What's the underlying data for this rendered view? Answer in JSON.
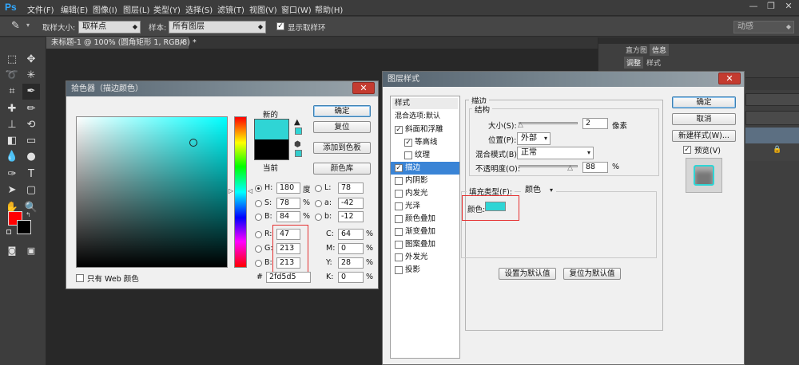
{
  "app": {
    "logo": "Ps",
    "menus": [
      "文件(F)",
      "编辑(E)",
      "图像(I)",
      "图层(L)",
      "类型(Y)",
      "选择(S)",
      "滤镜(T)",
      "视图(V)",
      "窗口(W)",
      "帮助(H)"
    ],
    "window_controls": [
      "—",
      "❐",
      "✕"
    ]
  },
  "options": {
    "sample_size_label": "取样大小:",
    "sample_size_value": "取样点",
    "sample_label": "样本:",
    "sample_value": "所有图层",
    "show_ring_label": "显示取样环",
    "workspace": "动感"
  },
  "document": {
    "tab_title": "未标题-1 @ 100% (圆角矩形 1, RGB/8) *",
    "close": "×"
  },
  "panels": {
    "tabs_top": [
      "直方图",
      "信息"
    ],
    "tabs_second": [
      "调整",
      "样式"
    ]
  },
  "picker": {
    "title": "拾色器（描边颜色）",
    "new_label": "新的",
    "current_label": "当前",
    "new_color": "#2fd5d5",
    "current_color": "#000000",
    "buttons": {
      "ok": "确定",
      "reset": "复位",
      "add_swatch": "添加到色板",
      "libraries": "颜色库"
    },
    "hsb": [
      {
        "label": "H:",
        "value": "180",
        "unit": "度",
        "selected": true
      },
      {
        "label": "S:",
        "value": "78",
        "unit": "%"
      },
      {
        "label": "B:",
        "value": "84",
        "unit": "%"
      }
    ],
    "rgb": [
      {
        "label": "R:",
        "value": "47"
      },
      {
        "label": "G:",
        "value": "213"
      },
      {
        "label": "B:",
        "value": "213"
      }
    ],
    "lab": [
      {
        "label": "L:",
        "value": "78"
      },
      {
        "label": "a:",
        "value": "-42"
      },
      {
        "label": "b:",
        "value": "-12"
      }
    ],
    "cmyk": [
      {
        "label": "C:",
        "value": "64",
        "unit": "%"
      },
      {
        "label": "M:",
        "value": "0",
        "unit": "%"
      },
      {
        "label": "Y:",
        "value": "28",
        "unit": "%"
      },
      {
        "label": "K:",
        "value": "0",
        "unit": "%"
      }
    ],
    "hex_label": "#",
    "hex": "2fd5d5",
    "web_only_label": "只有 Web 颜色",
    "hue_position": 0.5
  },
  "layer_style": {
    "title": "图层样式",
    "styles_header": "样式",
    "blend_default": "混合选项:默认",
    "items": [
      {
        "label": "斜面和浮雕",
        "checked": true
      },
      {
        "label": "等高线",
        "checked": true,
        "indent": true
      },
      {
        "label": "纹理",
        "checked": false,
        "indent": true
      },
      {
        "label": "描边",
        "checked": true,
        "selected": true
      },
      {
        "label": "内阴影",
        "checked": false
      },
      {
        "label": "内发光",
        "checked": false
      },
      {
        "label": "光泽",
        "checked": false
      },
      {
        "label": "颜色叠加",
        "checked": false
      },
      {
        "label": "渐变叠加",
        "checked": false
      },
      {
        "label": "图案叠加",
        "checked": false
      },
      {
        "label": "外发光",
        "checked": false
      },
      {
        "label": "投影",
        "checked": false
      }
    ],
    "section": "描边",
    "structure": "结构",
    "size_label": "大小(S):",
    "size_value": "2",
    "size_unit": "像素",
    "position_label": "位置(P):",
    "position_value": "外部",
    "blend_label": "混合模式(B):",
    "blend_value": "正常",
    "opacity_label": "不透明度(O):",
    "opacity_value": "88",
    "opacity_unit": "%",
    "fill_type_label": "填充类型(F):",
    "fill_type_value": "颜色",
    "color_label": "颜色:",
    "color_swatch": "#2fd5d5",
    "set_default": "设置为默认值",
    "reset_default": "复位为默认值",
    "buttons": {
      "ok": "确定",
      "cancel": "取消",
      "new_style": "新建样式(W)..."
    },
    "preview_label": "预览(V)",
    "preview_checked": true
  }
}
